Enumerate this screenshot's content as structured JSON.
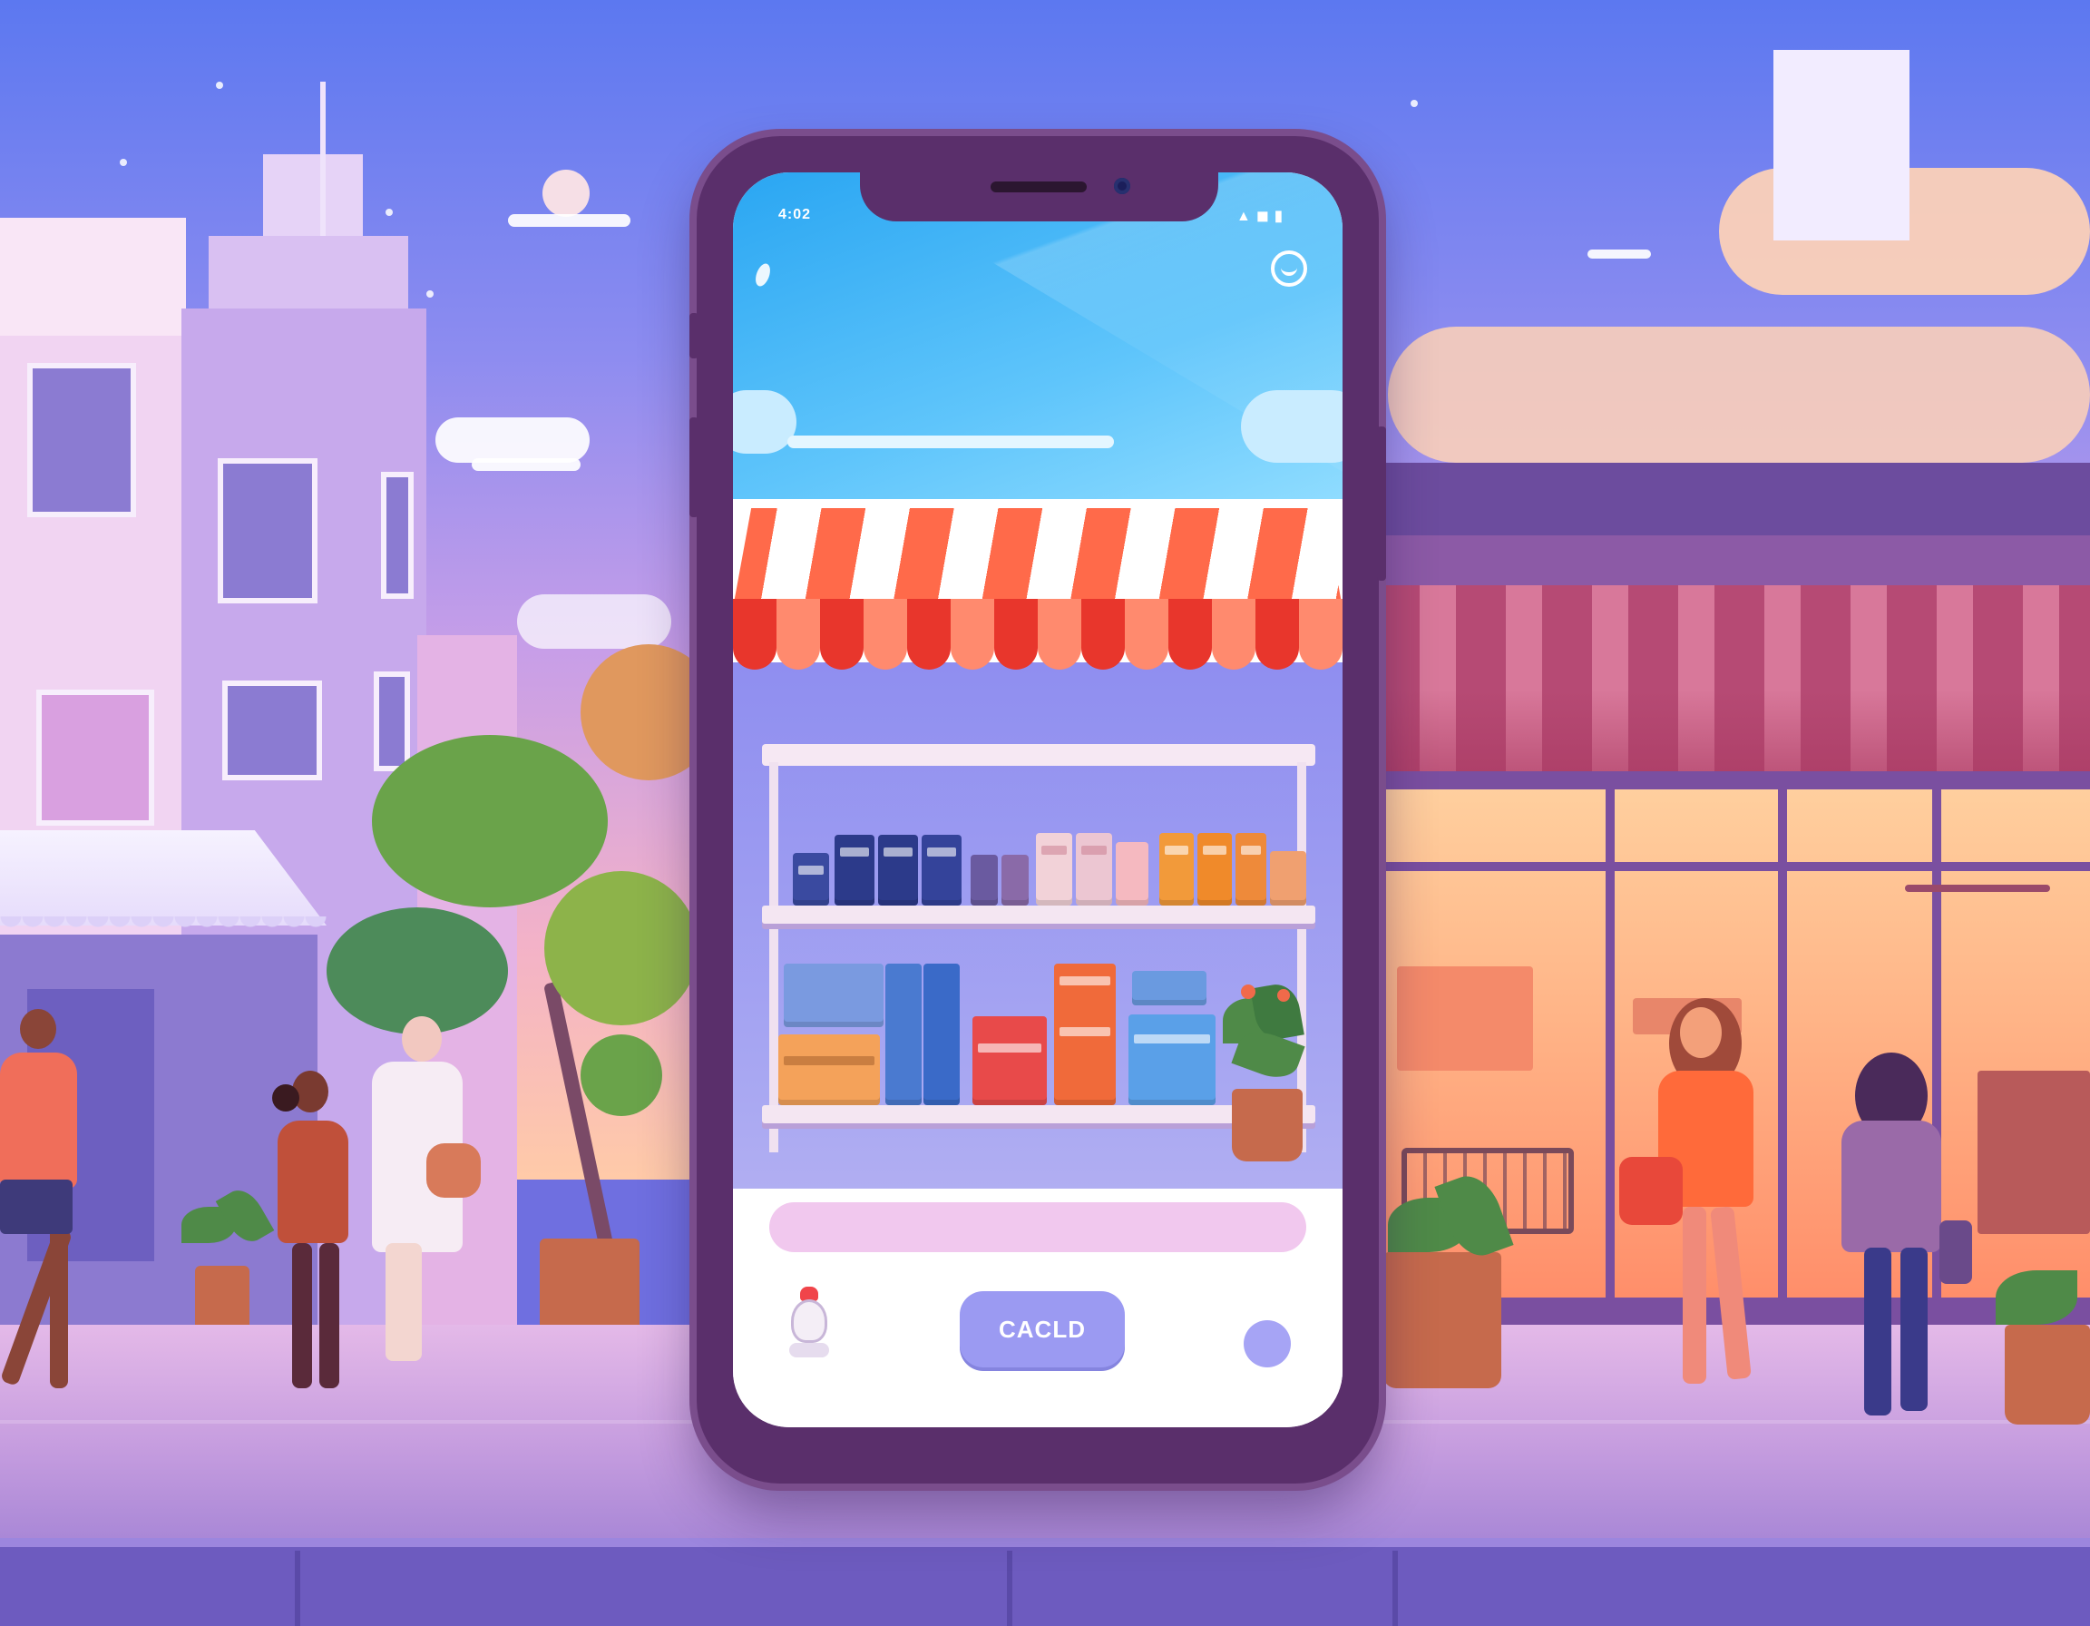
{
  "phone": {
    "status_left": "4:02",
    "status_right": "▲ ◼ ▮",
    "profile_icon": "profile-icon",
    "store_awning_colors": [
      "#ff6a4a",
      "#ffffff",
      "#ff8a6e",
      "#e8362c"
    ],
    "search": {
      "value": "",
      "placeholder": ""
    },
    "bag_icon": "bag-icon",
    "primary_button_label": "CACLD",
    "dot_button_icon": "circle-icon"
  },
  "colors": {
    "phone_frame": "#5a2f6b",
    "button": "#9b9af2",
    "search_bar": "#f1c8ee",
    "app_sky": "#2aa6f2"
  }
}
